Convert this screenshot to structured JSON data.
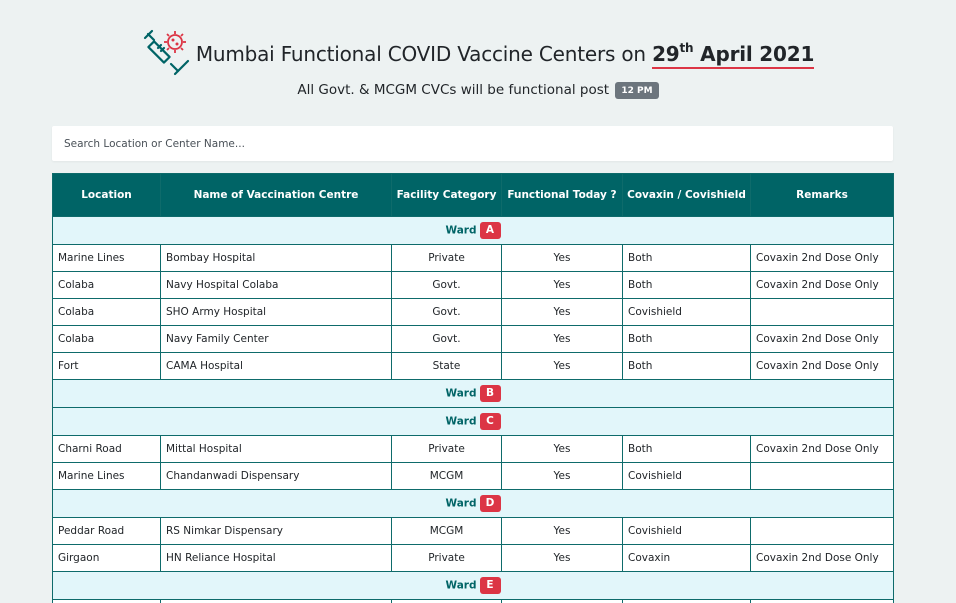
{
  "header": {
    "title_prefix": "Mumbai Functional COVID Vaccine Centers on",
    "date_day": "29",
    "date_suffix": "th",
    "date_rest": "April 2021",
    "subtitle": "All Govt. & MCGM CVCs will be functional post",
    "time_badge": "12 PM"
  },
  "search": {
    "placeholder": "Search Location or Center Name..."
  },
  "table": {
    "columns": [
      "Location",
      "Name of Vaccination Centre",
      "Facility Category",
      "Functional Today ?",
      "Covaxin / Covishield",
      "Remarks"
    ],
    "ward_label": "Ward",
    "wards": [
      {
        "ward": "A",
        "rows": [
          [
            "Marine Lines",
            "Bombay Hospital",
            "Private",
            "Yes",
            "Both",
            "Covaxin 2nd Dose Only"
          ],
          [
            "Colaba",
            "Navy Hospital Colaba",
            "Govt.",
            "Yes",
            "Both",
            "Covaxin 2nd Dose Only"
          ],
          [
            "Colaba",
            "SHO Army Hospital",
            "Govt.",
            "Yes",
            "Covishield",
            ""
          ],
          [
            "Colaba",
            "Navy Family Center",
            "Govt.",
            "Yes",
            "Both",
            "Covaxin 2nd Dose Only"
          ],
          [
            "Fort",
            "CAMA Hospital",
            "State",
            "Yes",
            "Both",
            "Covaxin 2nd Dose Only"
          ]
        ]
      },
      {
        "ward": "B",
        "rows": []
      },
      {
        "ward": "C",
        "rows": [
          [
            "Charni Road",
            "Mittal Hospital",
            "Private",
            "Yes",
            "Both",
            "Covaxin 2nd Dose Only"
          ],
          [
            "Marine Lines",
            "Chandanwadi Dispensary",
            "MCGM",
            "Yes",
            "Covishield",
            ""
          ]
        ]
      },
      {
        "ward": "D",
        "rows": [
          [
            "Peddar Road",
            "RS Nimkar Dispensary",
            "MCGM",
            "Yes",
            "Covishield",
            ""
          ],
          [
            "Girgaon",
            "HN Reliance Hospital",
            "Private",
            "Yes",
            "Covaxin",
            "Covaxin 2nd Dose Only"
          ]
        ]
      },
      {
        "ward": "E",
        "rows": [
          [
            "",
            "",
            "",
            "",
            "",
            ""
          ]
        ]
      }
    ]
  },
  "icons": {
    "logo": "vaccine-syringe-virus-icon"
  },
  "colors": {
    "header_bg": "#006466",
    "ward_bg": "#e2f6fa",
    "badge_red": "#dc3545",
    "page_bg": "#edf2f2"
  }
}
